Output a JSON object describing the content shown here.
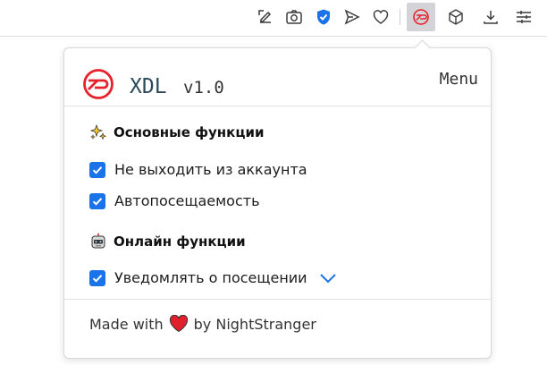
{
  "toolbar": {
    "icons": [
      "edit-pen-icon",
      "camera-icon",
      "shield-check-icon",
      "send-icon",
      "heart-outline-icon",
      "xdl-extension-icon",
      "cube-icon",
      "download-icon",
      "settings-sliders-icon"
    ]
  },
  "popup": {
    "title": "XDL",
    "version": "v1.0",
    "menu_label": "Menu",
    "sections": [
      {
        "title": "Основные функции",
        "icon": "sparkles-icon",
        "options": [
          {
            "label": "Не выходить из аккаунта",
            "checked": true
          },
          {
            "label": "Автопосещаемость",
            "checked": true
          }
        ]
      },
      {
        "title": "Онлайн функции",
        "icon": "robot-icon",
        "options": [
          {
            "label": "Уведомлять о посещении",
            "checked": true,
            "expandable": true
          }
        ]
      }
    ],
    "footer": {
      "prefix": "Made with",
      "suffix": "by NightStranger"
    }
  },
  "colors": {
    "accent": "#1a73e8",
    "logo_red": "#e8222d",
    "shield_blue": "#1a73e8"
  }
}
